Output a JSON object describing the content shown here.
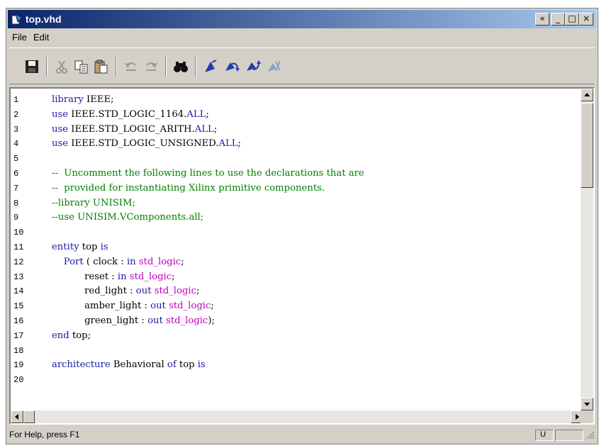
{
  "window": {
    "title": "top.vhd"
  },
  "title_buttons": {
    "restore": "«",
    "minimize": "_",
    "maximize": "□",
    "close": "×"
  },
  "menu": {
    "file": "File",
    "edit": "Edit"
  },
  "toolbar_icons": [
    "save-icon",
    "cut-icon",
    "copy-icon",
    "paste-icon",
    "undo-icon",
    "redo-icon",
    "find-icon",
    "bookmark-toggle-icon",
    "bookmark-next-icon",
    "bookmark-prev-icon",
    "bookmark-clear-icon"
  ],
  "colors": {
    "keyword": "#1a1aa6",
    "type": "#c000c0",
    "comment": "#008000",
    "titlebar_start": "#0a246a",
    "titlebar_end": "#a6caf0"
  },
  "editor": {
    "lines": [
      {
        "num": "1",
        "tokens": [
          [
            "kw",
            "library"
          ],
          [
            "tx",
            " IEEE;"
          ]
        ]
      },
      {
        "num": "2",
        "tokens": [
          [
            "kw",
            "use"
          ],
          [
            "tx",
            " IEEE.STD_LOGIC_1164."
          ],
          [
            "kw",
            "ALL"
          ],
          [
            "tx",
            ";"
          ]
        ]
      },
      {
        "num": "3",
        "tokens": [
          [
            "kw",
            "use"
          ],
          [
            "tx",
            " IEEE.STD_LOGIC_ARITH."
          ],
          [
            "kw",
            "ALL"
          ],
          [
            "tx",
            ";"
          ]
        ]
      },
      {
        "num": "4",
        "tokens": [
          [
            "kw",
            "use"
          ],
          [
            "tx",
            " IEEE.STD_LOGIC_UNSIGNED."
          ],
          [
            "kw",
            "ALL"
          ],
          [
            "tx",
            ";"
          ]
        ]
      },
      {
        "num": "5",
        "tokens": []
      },
      {
        "num": "6",
        "tokens": [
          [
            "cm",
            "--  Uncomment the following lines to use the declarations that are"
          ]
        ]
      },
      {
        "num": "7",
        "tokens": [
          [
            "cm",
            "--  provided for instantiating Xilinx primitive components."
          ]
        ]
      },
      {
        "num": "8",
        "tokens": [
          [
            "cm",
            "--library UNISIM;"
          ]
        ]
      },
      {
        "num": "9",
        "tokens": [
          [
            "cm",
            "--use UNISIM.VComponents.all;"
          ]
        ]
      },
      {
        "num": "10",
        "tokens": []
      },
      {
        "num": "11",
        "tokens": [
          [
            "kw",
            "entity"
          ],
          [
            "tx",
            " top "
          ],
          [
            "kw",
            "is"
          ]
        ]
      },
      {
        "num": "12",
        "tokens": [
          [
            "tx",
            "    "
          ],
          [
            "kw",
            "Port"
          ],
          [
            "tx",
            " ( clock : "
          ],
          [
            "kw",
            "in"
          ],
          [
            "tx",
            " "
          ],
          [
            "ty",
            "std_logic"
          ],
          [
            "tx",
            ";"
          ]
        ]
      },
      {
        "num": "13",
        "tokens": [
          [
            "tx",
            "           reset : "
          ],
          [
            "kw",
            "in"
          ],
          [
            "tx",
            " "
          ],
          [
            "ty",
            "std_logic"
          ],
          [
            "tx",
            ";"
          ]
        ]
      },
      {
        "num": "14",
        "tokens": [
          [
            "tx",
            "           red_light : "
          ],
          [
            "kw",
            "out"
          ],
          [
            "tx",
            " "
          ],
          [
            "ty",
            "std_logic"
          ],
          [
            "tx",
            ";"
          ]
        ]
      },
      {
        "num": "15",
        "tokens": [
          [
            "tx",
            "           amber_light : "
          ],
          [
            "kw",
            "out"
          ],
          [
            "tx",
            " "
          ],
          [
            "ty",
            "std_logic"
          ],
          [
            "tx",
            ";"
          ]
        ]
      },
      {
        "num": "16",
        "tokens": [
          [
            "tx",
            "           green_light : "
          ],
          [
            "kw",
            "out"
          ],
          [
            "tx",
            " "
          ],
          [
            "ty",
            "std_logic"
          ],
          [
            "tx",
            ");"
          ]
        ]
      },
      {
        "num": "17",
        "tokens": [
          [
            "kw",
            "end"
          ],
          [
            "tx",
            " top;"
          ]
        ]
      },
      {
        "num": "18",
        "tokens": []
      },
      {
        "num": "19",
        "tokens": [
          [
            "kw",
            "architecture"
          ],
          [
            "tx",
            " Behavioral "
          ],
          [
            "kw",
            "of"
          ],
          [
            "tx",
            " top "
          ],
          [
            "kw",
            "is"
          ]
        ]
      },
      {
        "num": "20",
        "tokens": []
      }
    ]
  },
  "status": {
    "help_text": "For Help, press F1",
    "panel_text": "U"
  }
}
